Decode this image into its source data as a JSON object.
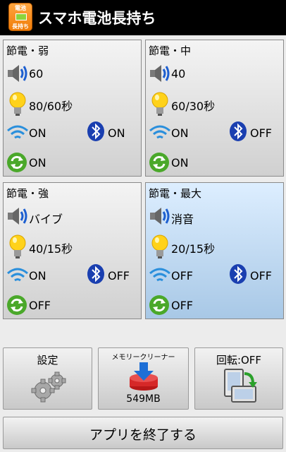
{
  "app": {
    "title": "スマホ電池長持ち",
    "icon_line1": "電池",
    "icon_line2": "長持ち"
  },
  "modes": [
    {
      "title": "節電・弱",
      "volume": "60",
      "screen": "80/60秒",
      "wifi": "ON",
      "bluetooth": "ON",
      "sync": "ON"
    },
    {
      "title": "節電・中",
      "volume": "40",
      "screen": "60/30秒",
      "wifi": "ON",
      "bluetooth": "OFF",
      "sync": "ON"
    },
    {
      "title": "節電・強",
      "volume": "バイブ",
      "screen": "40/15秒",
      "wifi": "ON",
      "bluetooth": "OFF",
      "sync": "OFF"
    },
    {
      "title": "節電・最大",
      "volume": "消音",
      "screen": "20/15秒",
      "wifi": "OFF",
      "bluetooth": "OFF",
      "sync": "OFF"
    }
  ],
  "selected_mode": "節電・最大",
  "buttons": {
    "settings": "設定",
    "memory_cleaner": "メモリークリーナー",
    "memory_value": "549MB",
    "rotation": "回転:OFF",
    "exit": "アプリを終了する"
  },
  "colors": {
    "selected_panel": "#bcd8f2",
    "accent": "#f08c1a"
  }
}
